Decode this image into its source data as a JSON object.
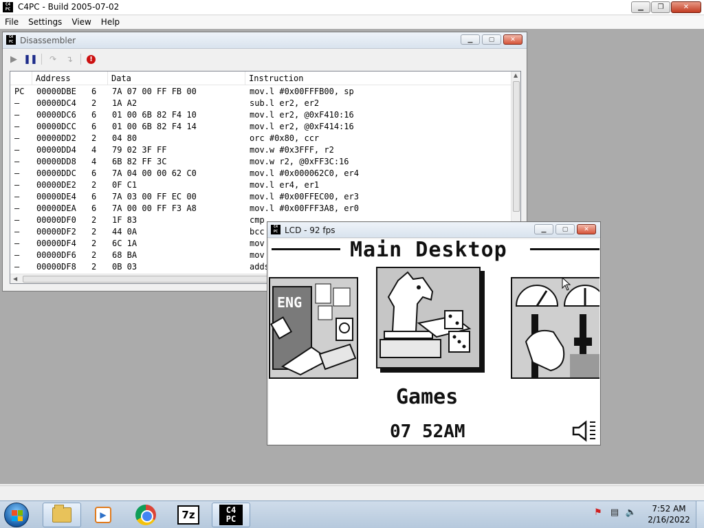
{
  "app": {
    "title": "C4PC - Build 2005-07-02",
    "icon_text_top": "C4",
    "icon_text_bottom": "PC"
  },
  "menu": [
    "File",
    "Settings",
    "View",
    "Help"
  ],
  "disassembler": {
    "title": "Disassembler",
    "toolbar": [
      "play-icon",
      "pause-icon",
      "step-into-icon",
      "step-over-icon",
      "stop-icon"
    ],
    "columns": [
      "Address",
      "Data",
      "Instruction"
    ],
    "rows": [
      {
        "marker": "PC",
        "address": "00000DBE",
        "len": "6",
        "data": "7A 07 00 FF FB 00",
        "instruction": "mov.l #0x00FFFB00, sp"
      },
      {
        "marker": "–",
        "address": "00000DC4",
        "len": "2",
        "data": "1A A2",
        "instruction": "sub.l er2, er2"
      },
      {
        "marker": "–",
        "address": "00000DC6",
        "len": "6",
        "data": "01 00 6B 82 F4 10",
        "instruction": "mov.l er2, @0xF410:16"
      },
      {
        "marker": "–",
        "address": "00000DCC",
        "len": "6",
        "data": "01 00 6B 82 F4 14",
        "instruction": "mov.l er2, @0xF414:16"
      },
      {
        "marker": "–",
        "address": "00000DD2",
        "len": "2",
        "data": "04 80",
        "instruction": "orc #0x80, ccr"
      },
      {
        "marker": "–",
        "address": "00000DD4",
        "len": "4",
        "data": "79 02 3F FF",
        "instruction": "mov.w #0x3FFF, r2"
      },
      {
        "marker": "–",
        "address": "00000DD8",
        "len": "4",
        "data": "6B 82 FF 3C",
        "instruction": "mov.w r2, @0xFF3C:16"
      },
      {
        "marker": "–",
        "address": "00000DDC",
        "len": "6",
        "data": "7A 04 00 00 62 C0",
        "instruction": "mov.l #0x000062C0, er4"
      },
      {
        "marker": "–",
        "address": "00000DE2",
        "len": "2",
        "data": "0F C1",
        "instruction": "mov.l er4, er1"
      },
      {
        "marker": "–",
        "address": "00000DE4",
        "len": "6",
        "data": "7A 03 00 FF EC 00",
        "instruction": "mov.l #0x00FFEC00, er3"
      },
      {
        "marker": "–",
        "address": "00000DEA",
        "len": "6",
        "data": "7A 00 00 FF F3 A8",
        "instruction": "mov.l #0x00FFF3A8, er0"
      },
      {
        "marker": "–",
        "address": "00000DF0",
        "len": "2",
        "data": "1F 83",
        "instruction": "cmp"
      },
      {
        "marker": "–",
        "address": "00000DF2",
        "len": "2",
        "data": "44 0A",
        "instruction": "bcc"
      },
      {
        "marker": "–",
        "address": "00000DF4",
        "len": "2",
        "data": "6C 1A",
        "instruction": "mov"
      },
      {
        "marker": "–",
        "address": "00000DF6",
        "len": "2",
        "data": "68 BA",
        "instruction": "mov"
      },
      {
        "marker": "–",
        "address": "00000DF8",
        "len": "2",
        "data": "0B 03",
        "instruction": "adds"
      }
    ]
  },
  "lcd": {
    "title": "LCD - 92 fps",
    "header": "Main Desktop",
    "tile_badge": "ENG",
    "caption": "Games",
    "clock": "07 52AM"
  },
  "taskbar": {
    "apps": [
      "explorer-icon",
      "media-player-icon",
      "chrome-icon",
      "7zip-icon",
      "c4pc-icon"
    ],
    "sevenzip_label": "7z",
    "time": "7:52 AM",
    "date": "2/16/2022"
  },
  "colors": {
    "workspace": "#ababab",
    "lcd_ink": "#111111",
    "close_red": "#c23b21"
  }
}
